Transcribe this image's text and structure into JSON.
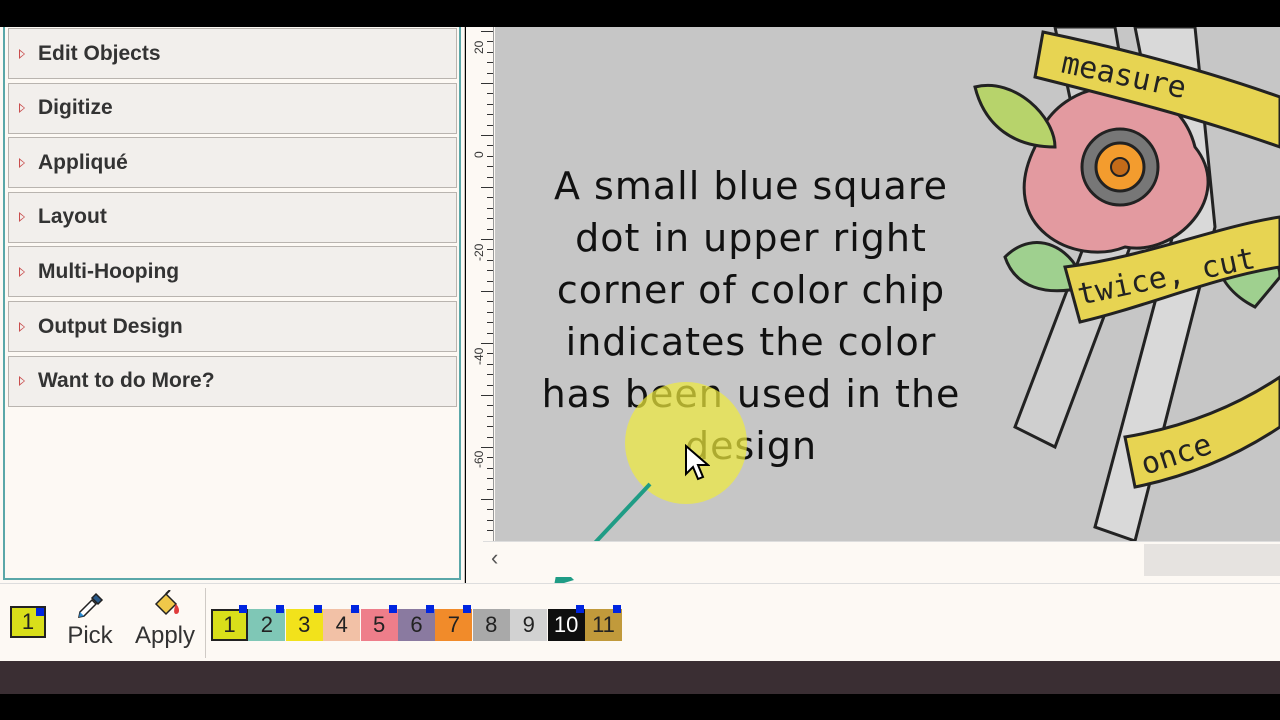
{
  "sidebar": {
    "sections": [
      {
        "label": "Edit Objects"
      },
      {
        "label": "Digitize"
      },
      {
        "label": "Appliqué"
      },
      {
        "label": "Layout"
      },
      {
        "label": "Multi-Hooping"
      },
      {
        "label": "Output Design"
      },
      {
        "label": "Want to do More?"
      }
    ]
  },
  "ruler": {
    "labels": [
      "20",
      "0",
      "-20",
      "-40",
      "-60"
    ]
  },
  "caption": "A small blue square dot in upper right corner of color chip indicates the color has been used in the design",
  "design_text": [
    "measure",
    "twice, cut",
    "once"
  ],
  "toolbar": {
    "current_color": {
      "number": "1",
      "color": "#d9df1a"
    },
    "pick_label": "Pick",
    "apply_label": "Apply",
    "chips": [
      {
        "number": "1",
        "color": "#d9df1a",
        "used": true
      },
      {
        "number": "2",
        "color": "#7fc7b6",
        "used": true
      },
      {
        "number": "3",
        "color": "#f2e21b",
        "used": true
      },
      {
        "number": "4",
        "color": "#f2c1a6",
        "used": true
      },
      {
        "number": "5",
        "color": "#ee7e8a",
        "used": true
      },
      {
        "number": "6",
        "color": "#8a7aa0",
        "used": true
      },
      {
        "number": "7",
        "color": "#f18b2a",
        "used": true
      },
      {
        "number": "8",
        "color": "#a9a9a9",
        "used": false
      },
      {
        "number": "9",
        "color": "#d2d2d2",
        "used": false
      },
      {
        "number": "10",
        "color": "#0f0f0f",
        "used": true
      },
      {
        "number": "11",
        "color": "#c19a3b",
        "used": true
      }
    ]
  }
}
